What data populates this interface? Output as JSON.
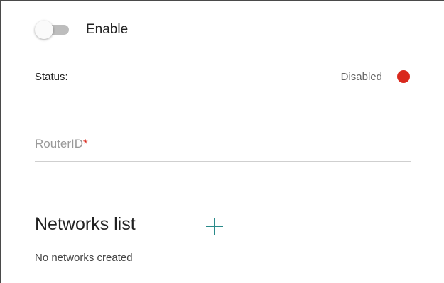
{
  "enable": {
    "label": "Enable",
    "state": "off"
  },
  "status": {
    "label": "Status:",
    "value": "Disabled",
    "indicator_color": "#d9291d"
  },
  "router_id": {
    "label": "RouterID",
    "required_mark": "*",
    "value": ""
  },
  "networks": {
    "title": "Networks list",
    "add_icon": "plus-icon",
    "empty_text": "No networks created"
  },
  "colors": {
    "accent": "#2a8a8a",
    "status_red": "#d9291d"
  }
}
